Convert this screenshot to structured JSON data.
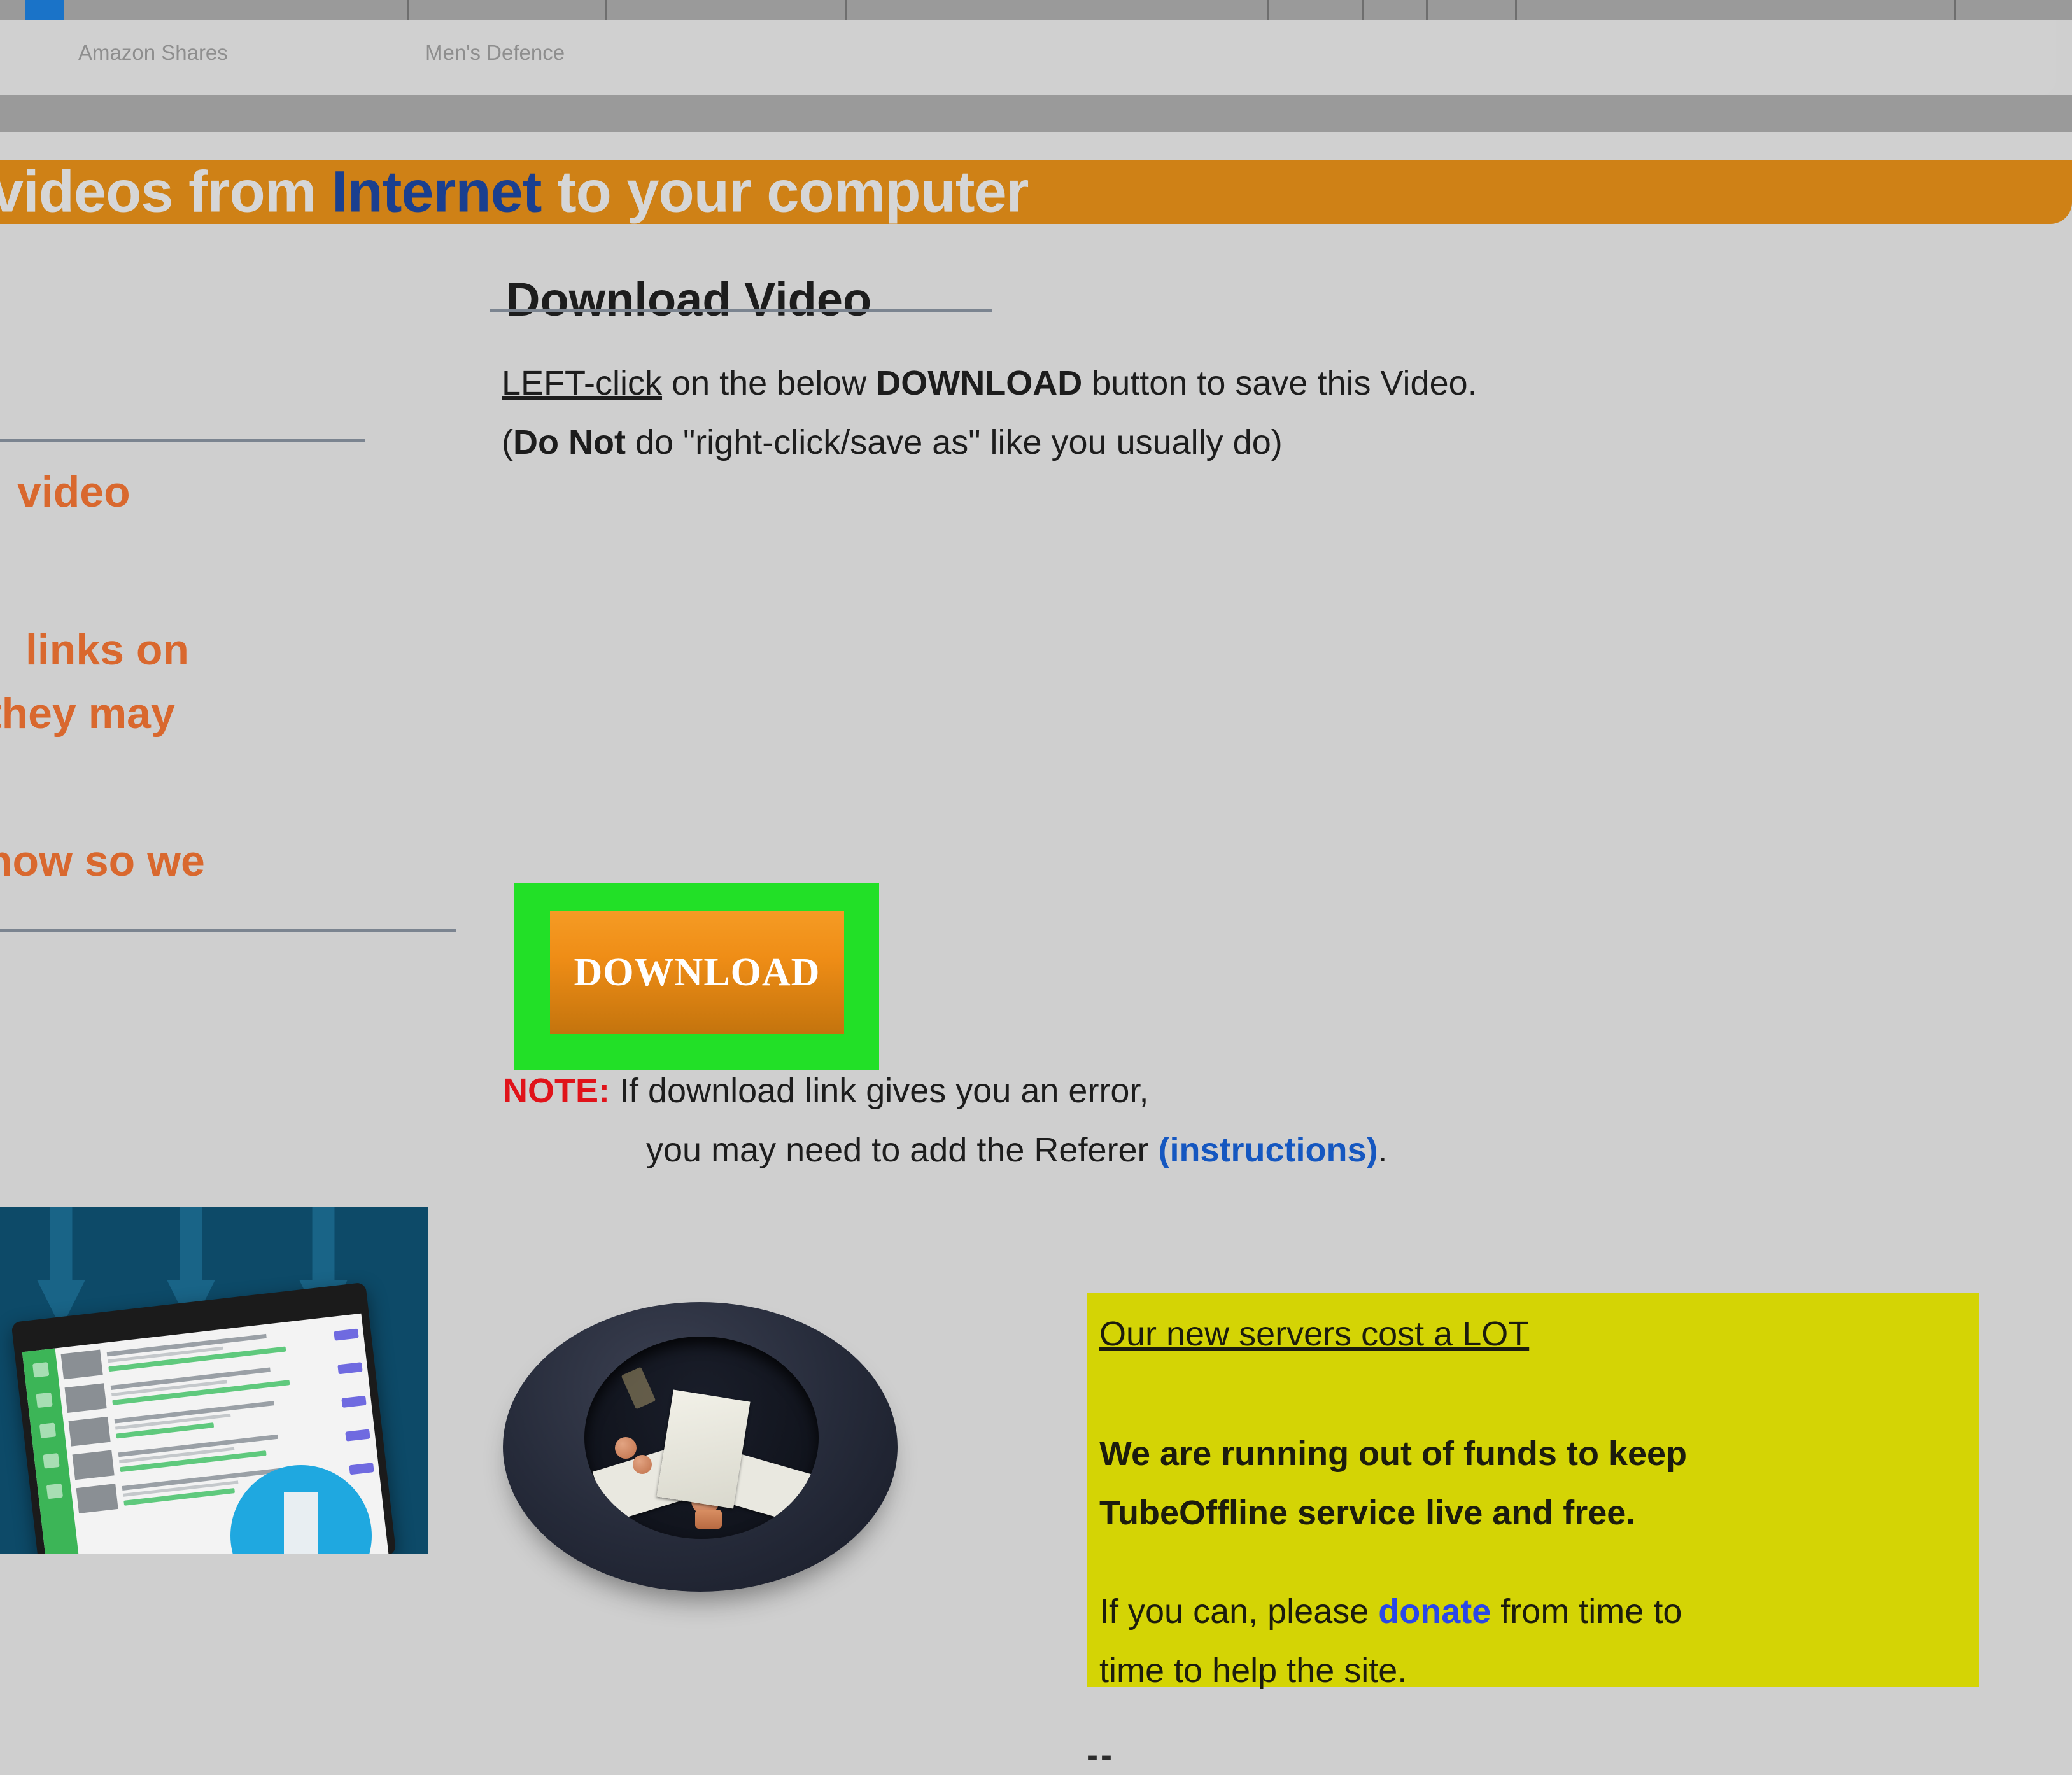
{
  "browser": {
    "bookmarks": [
      {
        "label": "Amazon Shares"
      },
      {
        "label": "Men's Defence"
      }
    ]
  },
  "banner": {
    "text_before": "videos from ",
    "highlight": "Internet",
    "text_after": " to your computer",
    "bg_color": "#cf8116",
    "text_color": "#d6d6d6",
    "highlight_color": "#1a3f8f"
  },
  "left_column": {
    "lines": [
      {
        "text": "video"
      },
      {
        "text": "links on"
      },
      {
        "text": "they may"
      },
      {
        "text": "now so we"
      }
    ],
    "text_color": "#d9682e"
  },
  "main": {
    "heading": "Download Video",
    "instruction_line_1": {
      "underlined": "LEFT-click",
      "middle": " on the below ",
      "bold": "DOWNLOAD",
      "tail": " button to save this Video."
    },
    "instruction_line_2": {
      "open": "(",
      "bold": "Do Not",
      "tail": " do \"right-click/save as\" like you usually do)"
    },
    "download_button": {
      "label": "DOWNLOAD",
      "highlight_color": "#22e027",
      "gradient_top": "#f59b24",
      "gradient_bottom": "#c4740d"
    },
    "note": {
      "keyword": "NOTE:",
      "keyword_color": "#e0131a",
      "line_1_tail": " If download link gives you an error,",
      "line_2_before": "you may need to add the Referer ",
      "line_2_link": "(instructions)",
      "line_2_link_color": "#1557c0",
      "line_2_tail": "."
    }
  },
  "donation": {
    "heading": "Our new servers cost a LOT",
    "body_line_1": "We are running out of funds to keep",
    "body_line_2": "TubeOffline service live and free.",
    "body_line_3_before": "If you can, please ",
    "body_line_3_link": "donate",
    "body_line_3_tail": " from time to",
    "body_line_4": "time to help the site.",
    "bg_color": "#d4d405",
    "link_color": "#2a47e8"
  },
  "signature": {
    "dashes": "--"
  },
  "ad_image": {
    "alt": "download-manager-advertisement"
  },
  "hat_image": {
    "alt": "hat-with-money-donation"
  }
}
